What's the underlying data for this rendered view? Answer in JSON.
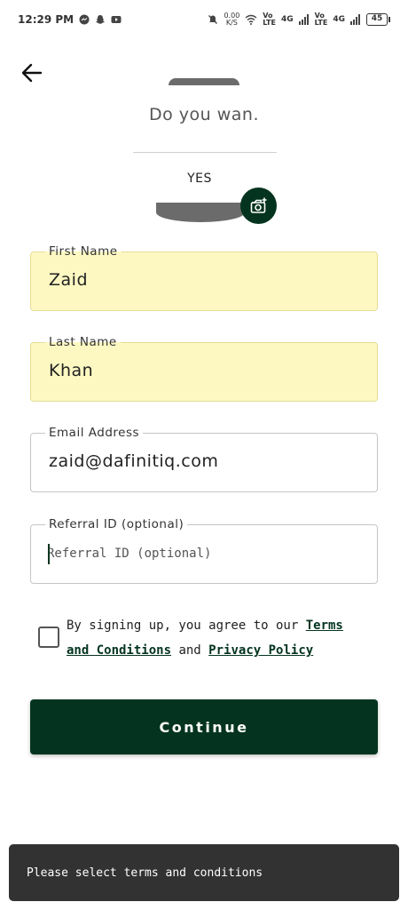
{
  "status_bar": {
    "time": "12:29 PM",
    "net_speed_value": "0.00",
    "net_speed_unit": "K/S",
    "sim1_type": "4G",
    "sim1_volte": "Vo",
    "sim1_lte": "LTE",
    "sim2_type": "4G",
    "sim2_volte": "Vo",
    "sim2_lte": "LTE",
    "battery": "45"
  },
  "avatar": {
    "prompt_text": "Do you wan.",
    "yes_text": "YES"
  },
  "form": {
    "first_name": {
      "label": "First Name",
      "value": "Zaid"
    },
    "last_name": {
      "label": "Last Name",
      "value": "Khan"
    },
    "email": {
      "label": "Email Address",
      "value": "zaid@dafinitiq.com"
    },
    "referral": {
      "label": "Referral ID (optional)",
      "placeholder": "Referral ID (optional)"
    }
  },
  "terms": {
    "prefix": "By signing up, you agree to our ",
    "terms_link": "Terms and Conditions",
    "middle": " and ",
    "privacy_link": "Privacy Policy"
  },
  "continue_label": "Continue",
  "snackbar_text": "Please select terms and conditions",
  "colors": {
    "primary": "#04341f",
    "filled_field": "#fdf8c2",
    "snackbar": "#323232"
  }
}
